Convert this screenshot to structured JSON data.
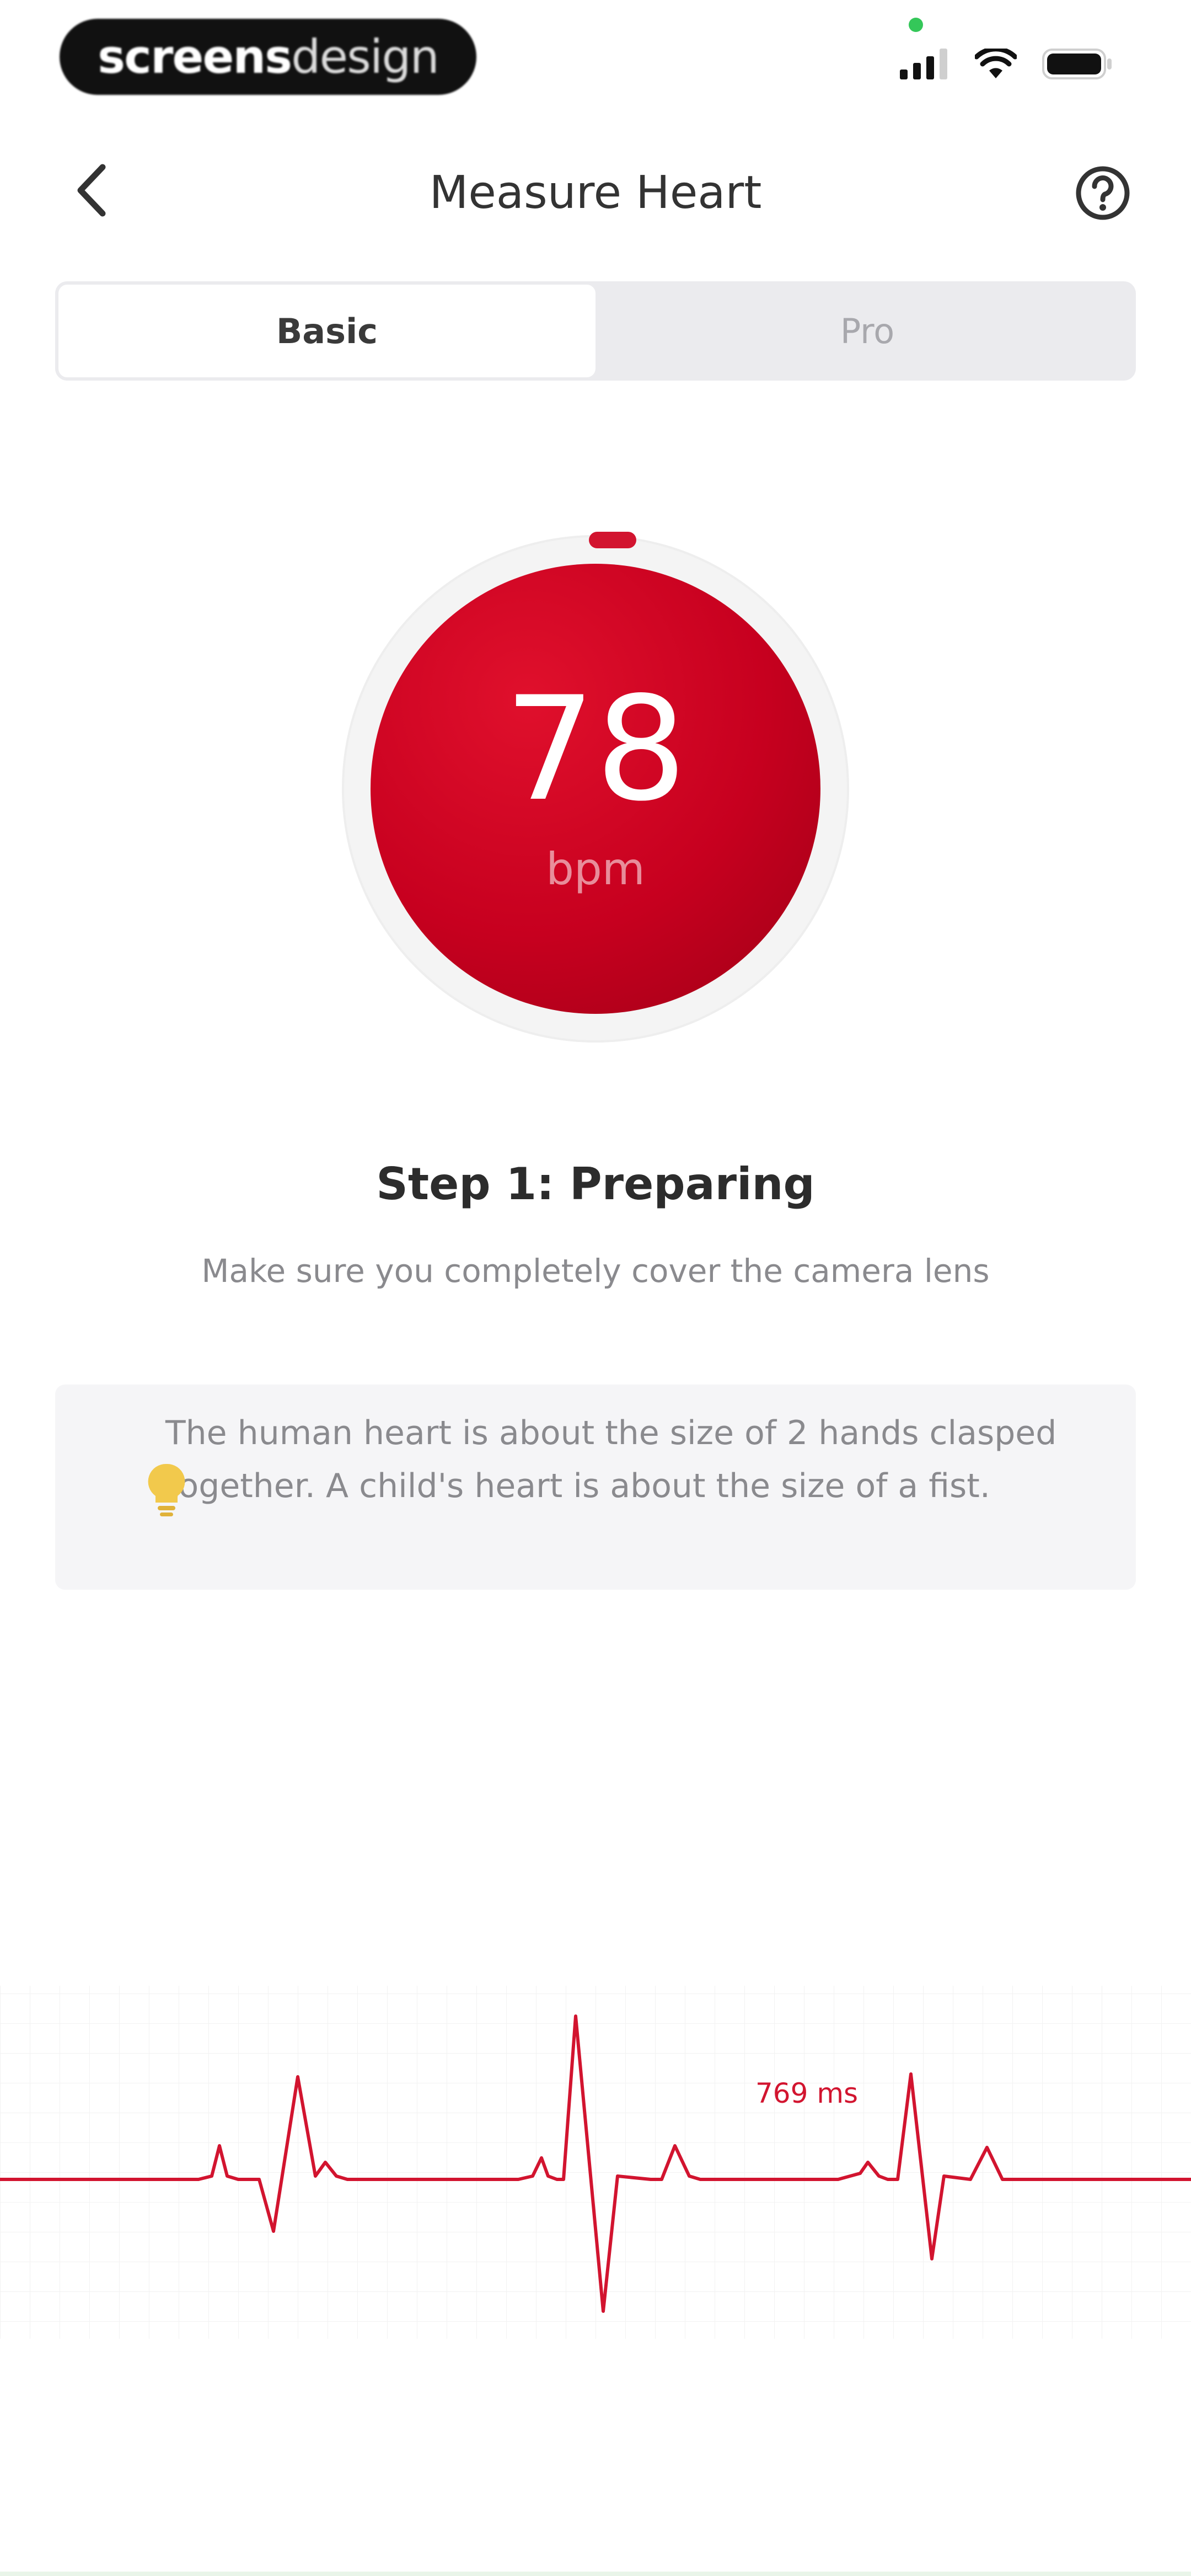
{
  "status_bar": {
    "brand_strong": "screens",
    "brand_light": "design"
  },
  "header": {
    "title": "Measure Heart",
    "back_icon": "chevron-left-icon",
    "help_icon": "help-circle-icon"
  },
  "tabs": [
    {
      "label": "Basic",
      "active": true
    },
    {
      "label": "Pro",
      "active": false
    }
  ],
  "heart_rate": {
    "value": "78",
    "unit": "bpm"
  },
  "step": {
    "title": "Step 1: Preparing",
    "description": "Make sure you completely cover the camera lens"
  },
  "tip": {
    "icon": "lightbulb-icon",
    "text": "The human heart is about the size of 2 hands clasped together. A child's heart is about the size of a fist."
  },
  "ecg": {
    "interval_label": "769 ms"
  },
  "colors": {
    "accent": "#c7001f",
    "tip_icon": "#f2c94c"
  }
}
